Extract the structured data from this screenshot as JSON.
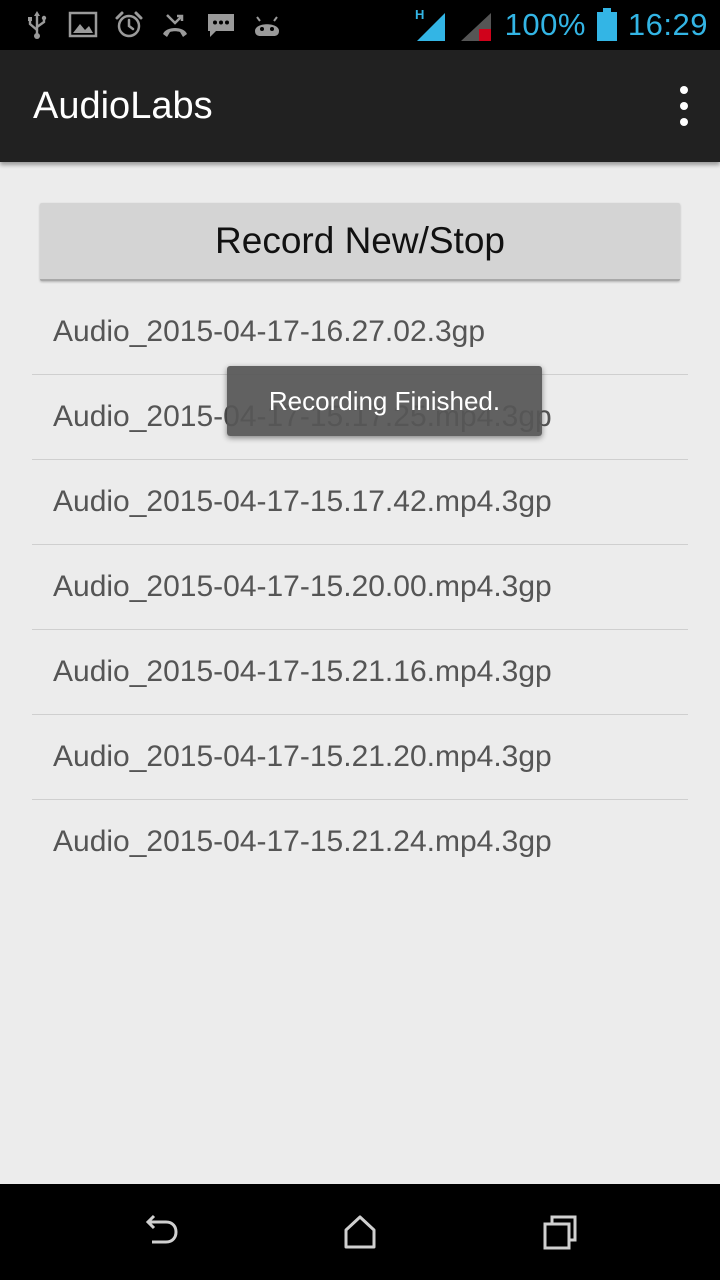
{
  "status_bar": {
    "left_icons": [
      "usb-icon",
      "image-icon",
      "alarm-icon",
      "missed-call-icon",
      "message-icon",
      "android-icon"
    ],
    "network_type": "H",
    "battery": "100%",
    "time": "16:29",
    "accent_color": "#33b5e5"
  },
  "app_bar": {
    "title": "AudioLabs",
    "overflow_icon": "more-vert-icon"
  },
  "main": {
    "record_button_label": "Record New/Stop",
    "files": [
      "Audio_2015-04-17-16.27.02.3gp",
      "Audio_2015-04-17-15.17.25.mp4.3gp",
      "Audio_2015-04-17-15.17.42.mp4.3gp",
      "Audio_2015-04-17-15.20.00.mp4.3gp",
      "Audio_2015-04-17-15.21.16.mp4.3gp",
      "Audio_2015-04-17-15.21.20.mp4.3gp",
      "Audio_2015-04-17-15.21.24.mp4.3gp"
    ]
  },
  "toast": {
    "message": "Recording Finished."
  },
  "nav_bar": {
    "buttons": [
      "back-icon",
      "home-icon",
      "recent-apps-icon"
    ]
  }
}
